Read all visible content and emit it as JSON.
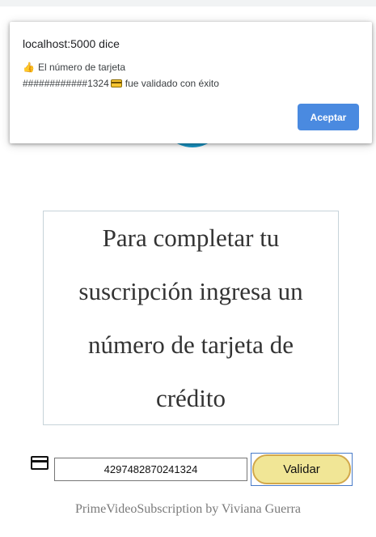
{
  "dialog": {
    "title": "localhost:5000 dice",
    "line1": "El número de tarjeta",
    "line2_masked": "############1324",
    "line2_suffix": "fue validado con éxito",
    "accept_label": "Aceptar",
    "thumb_glyph": "👍"
  },
  "info": {
    "text": "Para completar tu suscripción ingresa un número de tarjeta de crédito"
  },
  "form": {
    "card_number_value": "4297482870241324",
    "validate_label": "Validar"
  },
  "footer": {
    "text": "PrimeVideoSubscription by Viviana Guerra"
  },
  "colors": {
    "accent_button": "#4a8ae0",
    "validate_bg": "#f1e696",
    "validate_border": "#d2a84b",
    "logo": "#1a98c9"
  },
  "icons": [
    "thumbs-up-icon",
    "credit-card-emoji-icon",
    "credit-card-icon"
  ]
}
